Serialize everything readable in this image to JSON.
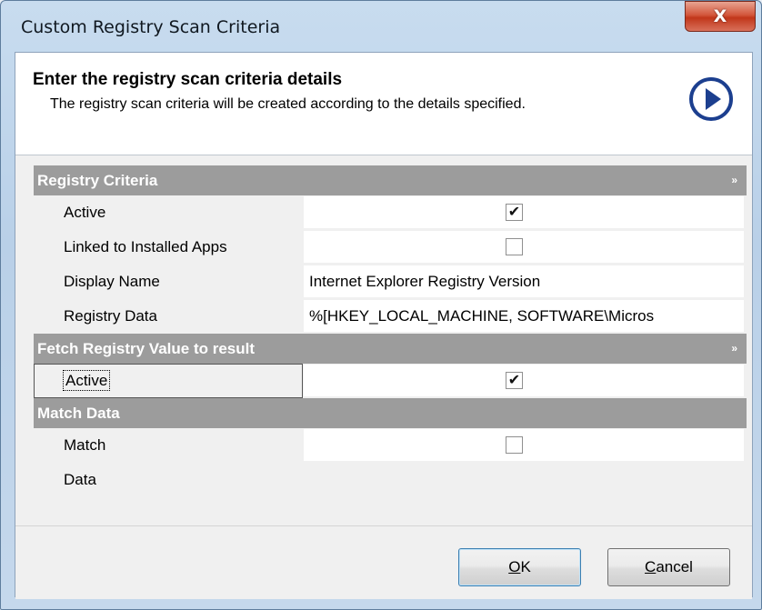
{
  "window": {
    "title": "Custom Registry Scan Criteria",
    "close_label": "X"
  },
  "header": {
    "title": "Enter the registry scan criteria details",
    "description": "The registry scan criteria will be created according to the details specified.",
    "next_icon": "arrow-circle-right-icon"
  },
  "categories": [
    {
      "label": "Registry Criteria",
      "toggle": "»",
      "rows": [
        {
          "label": "Active",
          "type": "checkbox",
          "checked": true
        },
        {
          "label": "Linked to Installed Apps",
          "type": "checkbox",
          "checked": false
        },
        {
          "label": "Display Name",
          "type": "text",
          "value": "Internet Explorer Registry Version"
        },
        {
          "label": "Registry Data",
          "type": "text",
          "value": "%[HKEY_LOCAL_MACHINE, SOFTWARE\\Micros"
        }
      ]
    },
    {
      "label": "Fetch Registry Value to result",
      "toggle": "»",
      "rows": [
        {
          "label": "Active",
          "type": "checkbox",
          "checked": true
        }
      ]
    },
    {
      "label": "Match Data",
      "toggle": "",
      "rows": [
        {
          "label": "Match",
          "type": "checkbox",
          "checked": false
        },
        {
          "label": "Data",
          "type": "text",
          "value": ""
        }
      ]
    }
  ],
  "check_glyph": "✔",
  "buttons": {
    "ok_mnemonic": "O",
    "ok_rest": "K",
    "cancel_mnemonic": "C",
    "cancel_rest": "ancel"
  }
}
